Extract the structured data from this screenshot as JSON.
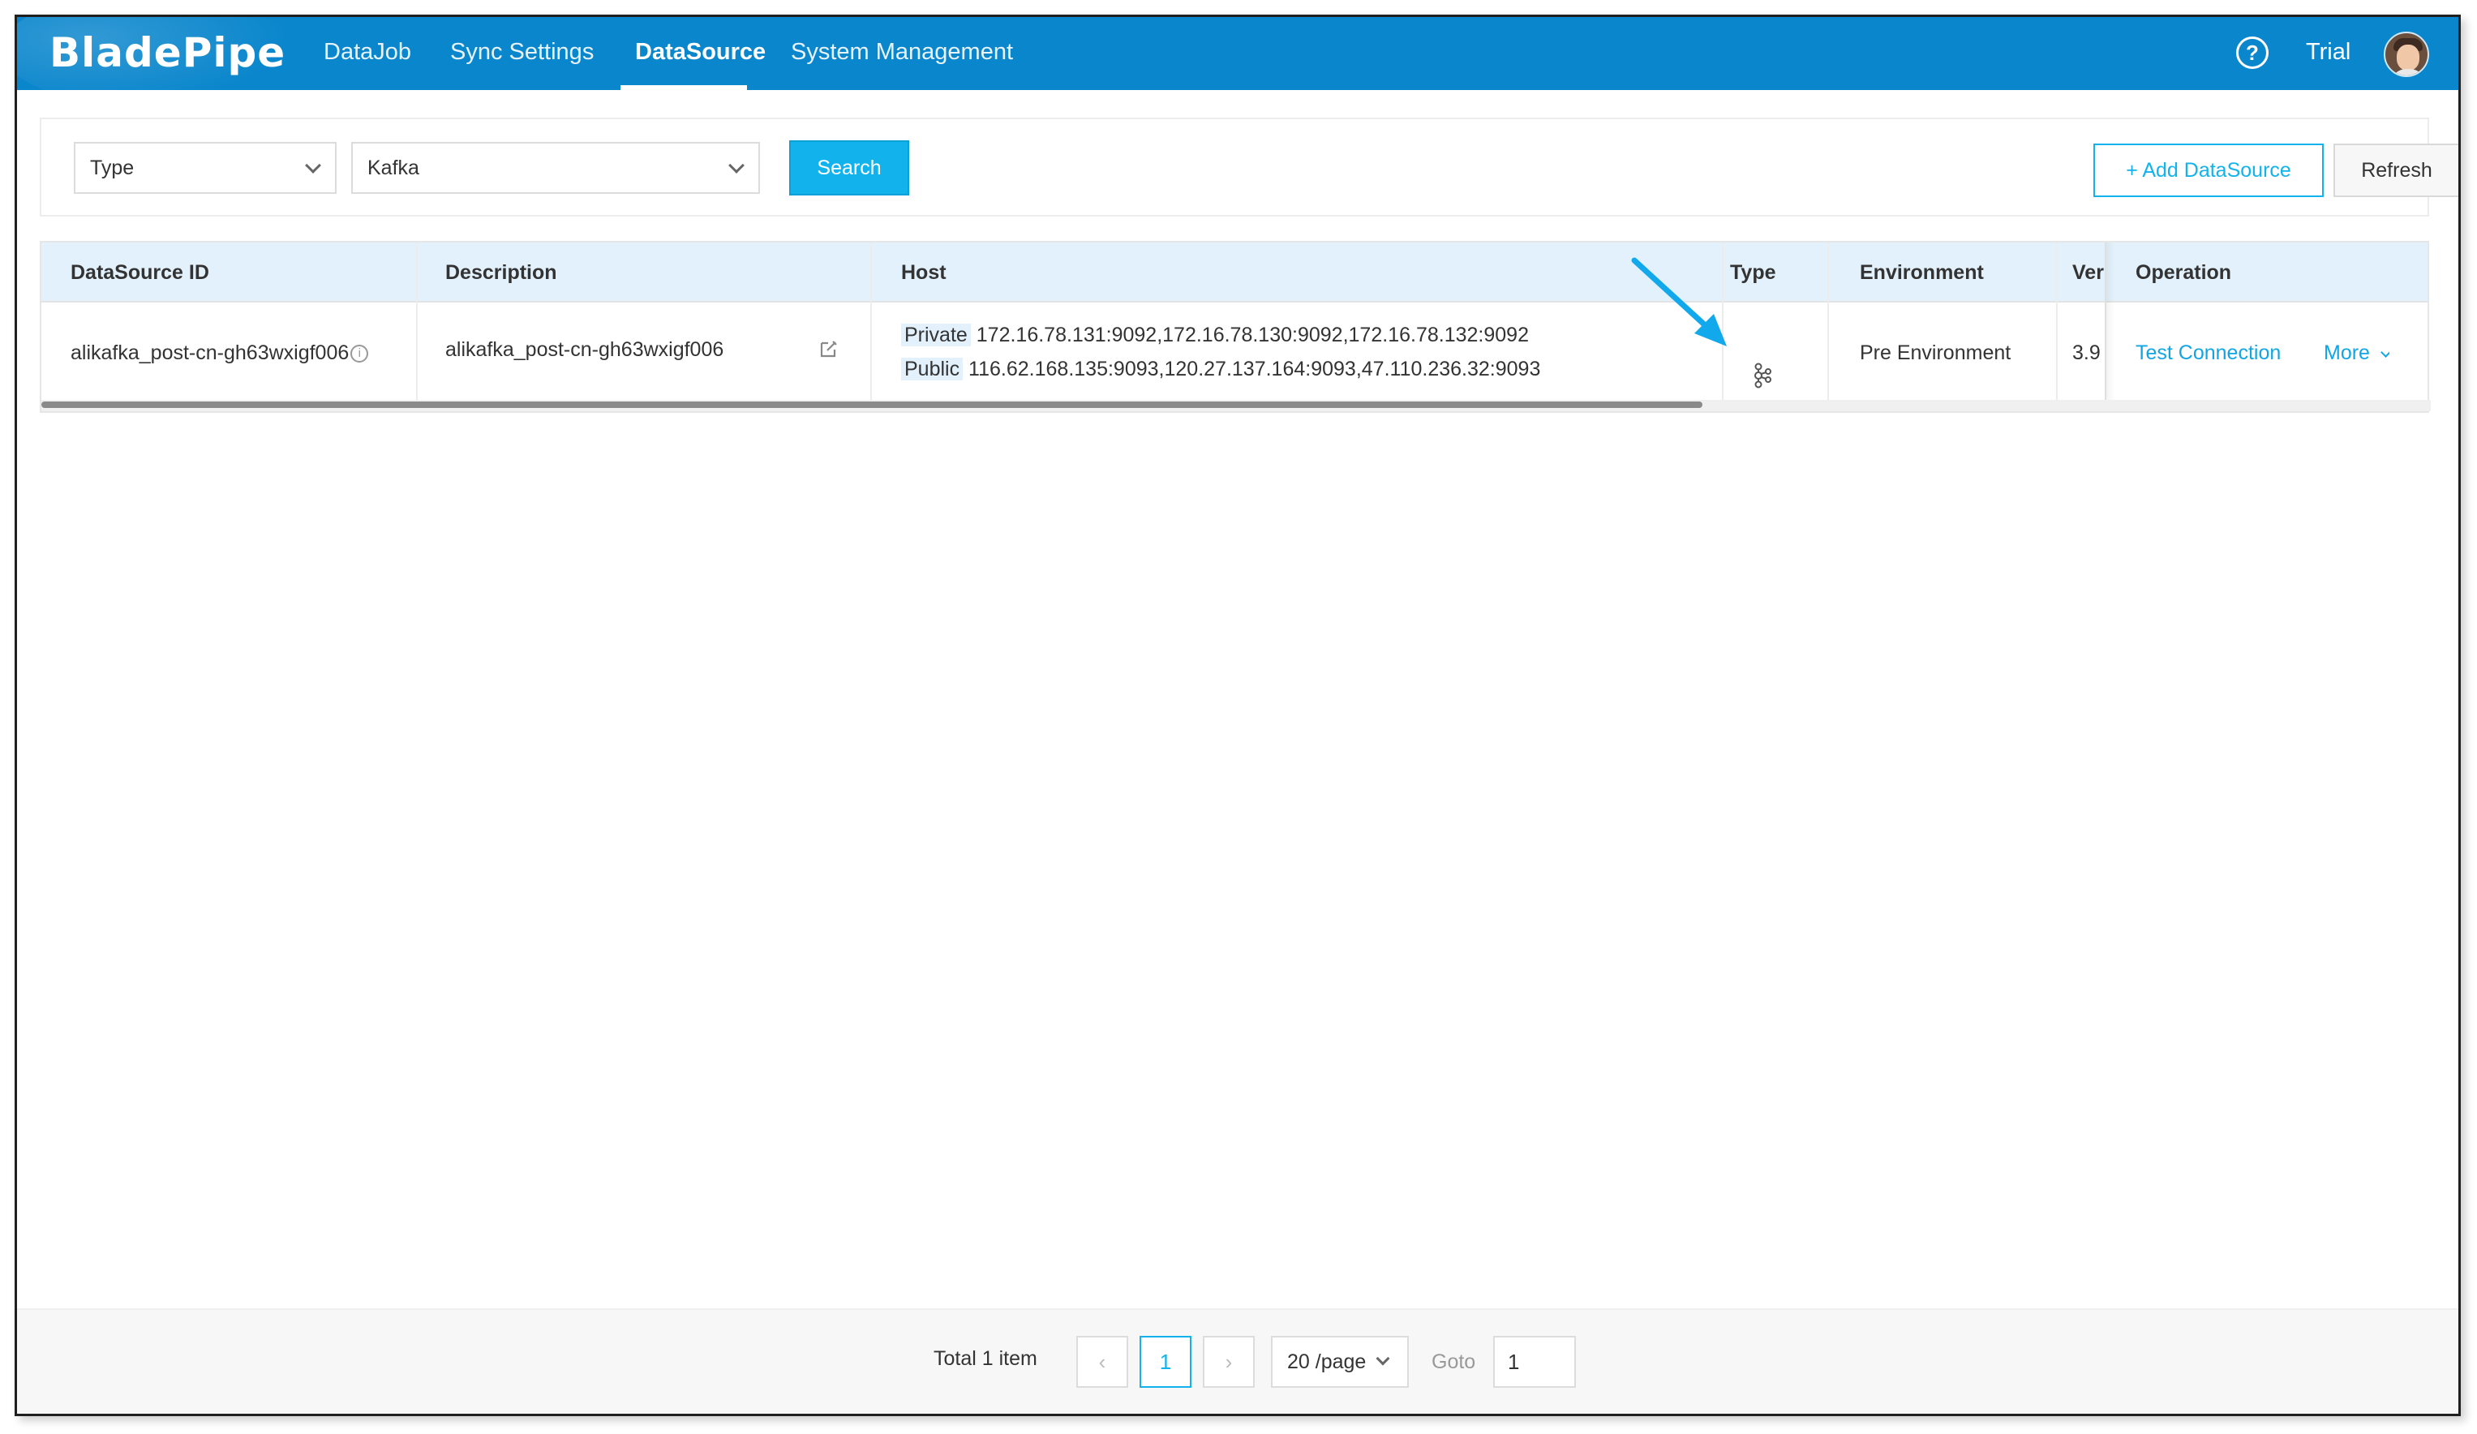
{
  "app": {
    "logo_text": "BladePipe"
  },
  "nav": {
    "items": [
      {
        "label": "DataJob"
      },
      {
        "label": "Sync Settings"
      },
      {
        "label": "DataSource",
        "active": true
      },
      {
        "label": "System Management"
      }
    ],
    "help_glyph": "?",
    "user_label": "Trial"
  },
  "filters": {
    "type_select": {
      "value": "Type"
    },
    "value_select": {
      "value": "Kafka"
    },
    "search_label": "Search",
    "add_label": "+ Add DataSource",
    "refresh_label": "Refresh"
  },
  "table": {
    "columns": [
      "DataSource ID",
      "Description",
      "Host",
      "Type",
      "Environment",
      "Version",
      "Operation"
    ],
    "rows": [
      {
        "id": "alikafka_post-cn-gh63wxigf006",
        "description": "alikafka_post-cn-gh63wxigf006",
        "host_private_label": "Private",
        "host_private": "172.16.78.131:9092,172.16.78.130:9092,172.16.78.132:9092",
        "host_public_label": "Public",
        "host_public": "116.62.168.135:9093,120.27.137.164:9093,47.110.236.32:9093",
        "type_icon": "kafka-icon",
        "environment": "Pre Environment",
        "version": "3.9",
        "op_test": "Test Connection",
        "op_more": "More"
      }
    ]
  },
  "pagination": {
    "total_text": "Total 1 item",
    "prev_glyph": "‹",
    "current_page": "1",
    "next_glyph": "›",
    "page_size": "20 /page",
    "goto_label": "Goto",
    "goto_value": "1"
  },
  "colors": {
    "nav_bg": "#0a86cc",
    "accent": "#12b3ec",
    "link": "#12a5e3",
    "table_header_bg": "#e2f1fb",
    "arrow": "#12a9ec"
  }
}
